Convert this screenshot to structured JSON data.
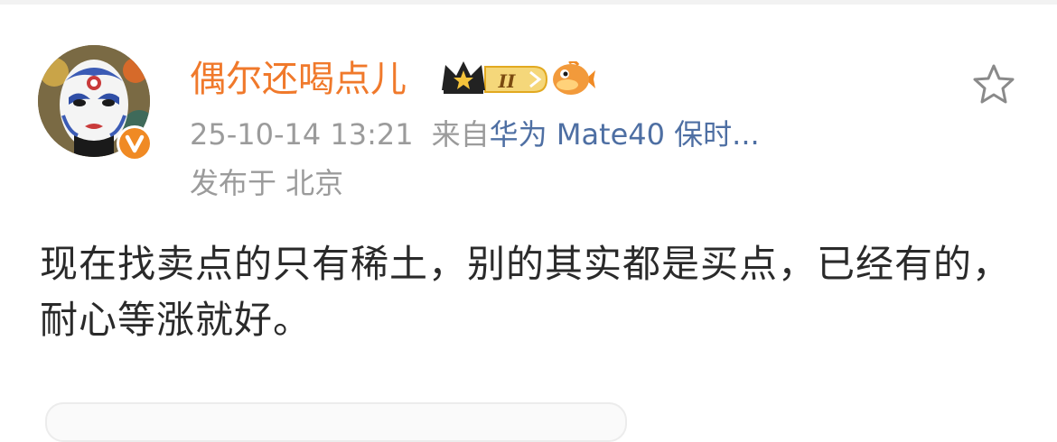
{
  "post": {
    "username": "偶尔还喝点儿",
    "level_badge": "II",
    "timestamp": "25-10-14 13:21",
    "source_prefix": "来自",
    "source_device": "华为 Mate40 保时...",
    "location": "发布于 北京",
    "content": "现在找卖点的只有稀土，别的其实都是买点，已经有的，耐心等涨就好。"
  },
  "icons": {
    "avatar": "opera-mask-avatar",
    "verified": "verified-v-icon",
    "crown": "crown-icon",
    "fish": "fish-icon",
    "favorite": "star-icon"
  },
  "colors": {
    "username": "#f0792b",
    "meta": "#9b9b9b",
    "device_link": "#4e6fa3",
    "body_text": "#2a2a2a",
    "verified_badge": "#f08a24",
    "badge_gold": "#f5c33b"
  }
}
